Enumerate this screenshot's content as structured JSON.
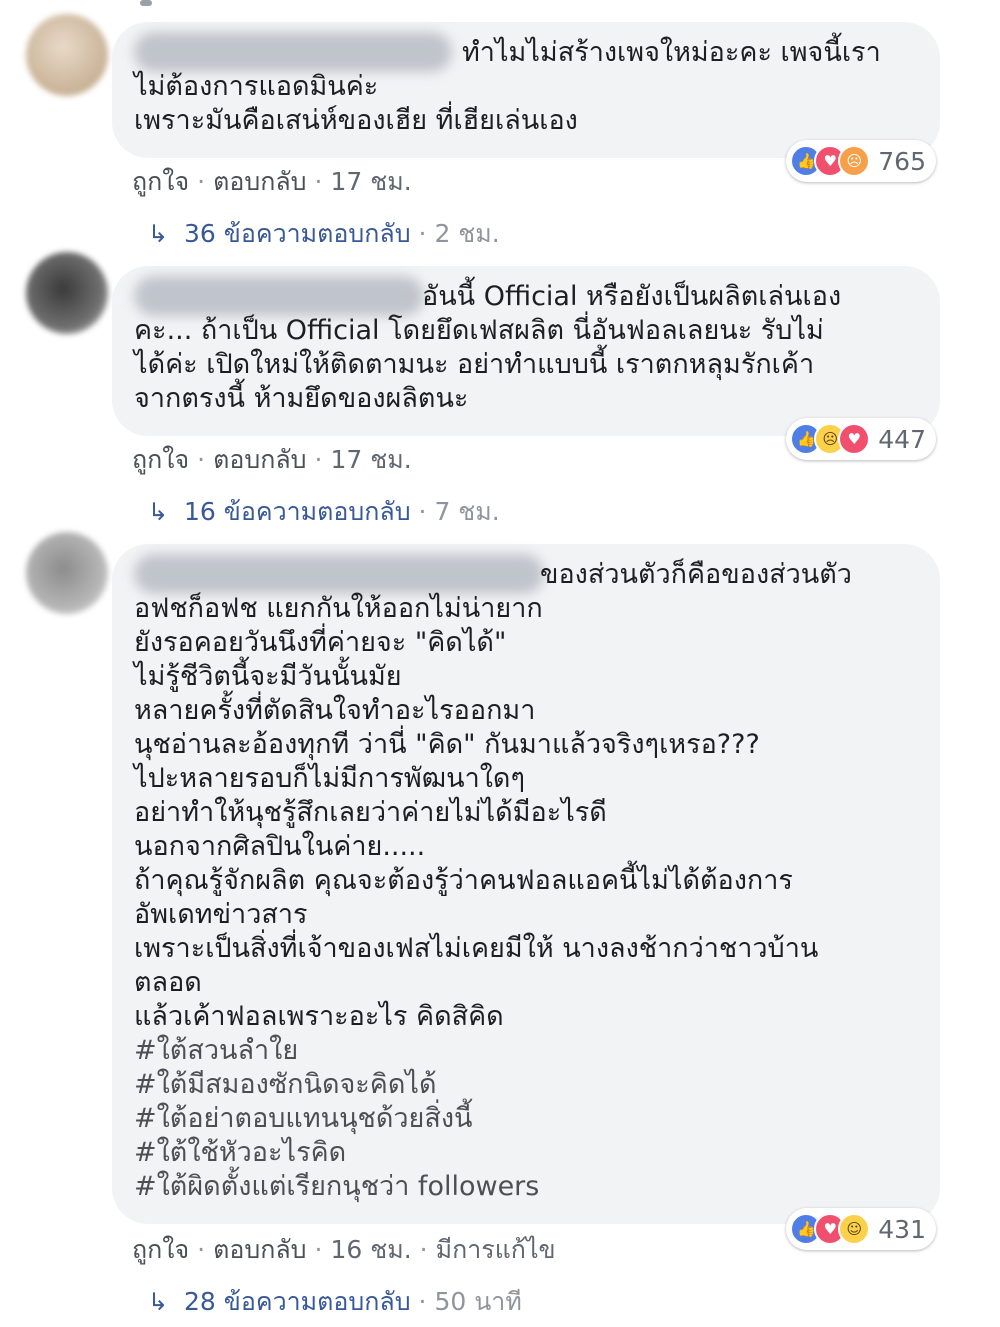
{
  "comments": [
    {
      "reaction_count": "765",
      "reactions": [
        "like",
        "love",
        "angry"
      ],
      "lines": [
        "ทำไมไม่สร้างเพจใหม่อะคะ เพจนี้เรา",
        "ไม่ต้องการแอดมินค่ะ",
        "เพราะมันคือเสน่ห์ของเฮีย ที่เฮียเล่นเอง"
      ],
      "like_label": "ถูกใจ",
      "reply_label": "ตอบกลับ",
      "time": "17 ชม.",
      "edited": "",
      "replies_label": "36 ข้อความตอบกลับ",
      "replies_time": "2 ชม."
    },
    {
      "reaction_count": "447",
      "reactions": [
        "like",
        "sad",
        "love"
      ],
      "lines": [
        "อันนี้ Official หรือยังเป็นผลิตเล่นเอง",
        "คะ... ถ้าเป็น Official โดยยึดเฟสผลิต นี่อันฟอลเลยนะ รับไม่",
        "ได้ค่ะ เปิดใหม่ให้ติดตามนะ อย่าทำแบบนี้ เราตกหลุมรักเค้า",
        "จากตรงนี้ ห้ามยึดของผลิตนะ"
      ],
      "like_label": "ถูกใจ",
      "reply_label": "ตอบกลับ",
      "time": "17 ชม.",
      "edited": "",
      "replies_label": "16 ข้อความตอบกลับ",
      "replies_time": "7 ชม."
    },
    {
      "reaction_count": "431",
      "reactions": [
        "like",
        "love",
        "haha"
      ],
      "lines": [
        "ของส่วนตัวก็คือของส่วนตัว",
        "อฟชก็อฟช แยกกันให้ออกไม่น่ายาก",
        "ยังรอคอยวันนึงที่ค่ายจะ \"คิดได้\"",
        "ไม่รู้ชีวิตนี้จะมีวันนั้นมัย",
        "หลายครั้งที่ตัดสินใจทำอะไรออกมา",
        "นุชอ่านละอ้องทุกที ว่านี่ \"คิด\" กันมาแล้วจริงๆเหรอ???",
        "ไปะหลายรอบก็ไม่มีการพัฒนาใดๆ",
        "อย่าทำให้นุชรู้สึกเลยว่าค่ายไม่ได้มีอะไรดี",
        "นอกจากศิลปินในค่าย.....",
        "ถ้าคุณรู้จักผลิต คุณจะต้องรู้ว่าคนฟอลแอคนี้ไม่ได้ต้องการ",
        "อัพเดทข่าวสาร",
        "เพราะเป็นสิ่งที่เจ้าของเฟสไม่เคยมีให้ นางลงช้ากว่าชาวบ้าน",
        "ตลอด",
        "แล้วเค้าฟอลเพราะอะไร คิดสิคิด"
      ],
      "hashtags": [
        "#ใต้สวนลำใย",
        "#ใต้มีสมองซักนิดจะคิดได้",
        "#ใต้อย่าตอบแทนนุชด้วยสิ่งนี้",
        "#ใต้ใช้หัวอะไรคิด",
        "#ใต้ผิดตั้งแต่เรียกนุชว่า followers"
      ],
      "like_label": "ถูกใจ",
      "reply_label": "ตอบกลับ",
      "time": "16 ชม.",
      "edited": "มีการแก้ไข",
      "replies_label": "28 ข้อความตอบกลับ",
      "replies_time": "50 นาที"
    }
  ],
  "colors": {
    "bubble": "#f2f3f5",
    "link": "#385898",
    "meta": "#606770"
  },
  "icons": {
    "like": "thumbs-up-icon",
    "love": "heart-icon",
    "angry": "angry-face-icon",
    "sad": "sad-face-icon",
    "haha": "laughing-face-icon",
    "reply_arrow": "reply-arrow-icon"
  }
}
